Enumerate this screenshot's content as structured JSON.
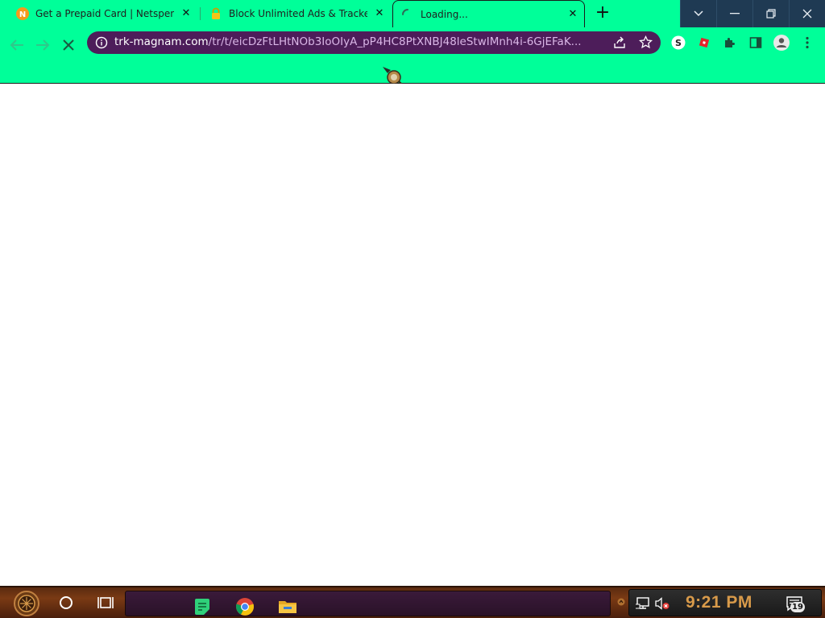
{
  "browser": {
    "tabs": [
      {
        "title": "Get a Prepaid Card | Netspend",
        "favicon": "netspend-icon",
        "favicon_letter": "N",
        "active": false
      },
      {
        "title": "Block Unlimited Ads & Trackers",
        "favicon": "lock-icon",
        "active": false
      },
      {
        "title": "Loading...",
        "favicon": "loading-spinner-icon",
        "active": true
      }
    ],
    "new_tab_label": "+",
    "address_bar": {
      "domain": "trk-magnam.com",
      "path": "/tr/t/eicDzFtLHtNOb3IoOIyA_pP4HC8PtXNBJ48leStwIMnh4i-6GjEFaK..."
    },
    "theme_color": "#00ff99",
    "omnibox_color": "#4d1d5a"
  },
  "taskbar": {
    "clock": "9:21 PM",
    "notification_count": "19",
    "pinned_apps": [
      "notes-app-icon",
      "chrome-icon",
      "file-explorer-icon"
    ]
  }
}
